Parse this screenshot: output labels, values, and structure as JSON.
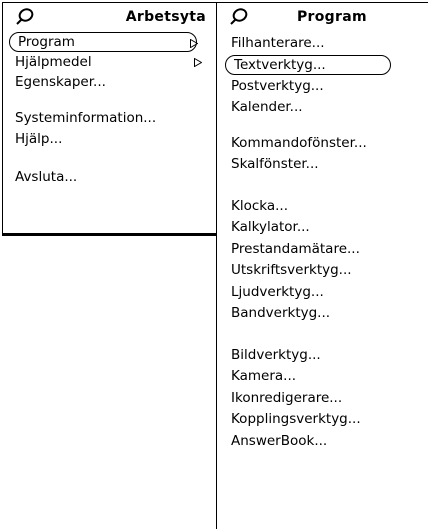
{
  "workspace_menu": {
    "title": "Arbetsyta",
    "items": [
      {
        "label": "Program",
        "icon": "submenu-arrow-icon",
        "default": true
      },
      {
        "label": "Hjälpmedel",
        "icon": "submenu-arrow-icon"
      },
      {
        "label": "Egenskaper..."
      },
      {
        "label": "Systeminformation..."
      },
      {
        "label": "Hjälp..."
      },
      {
        "label": "Avsluta..."
      }
    ]
  },
  "program_menu": {
    "title": "Program",
    "items": [
      {
        "label": "Filhanterare..."
      },
      {
        "label": "Textverktyg...",
        "default": true
      },
      {
        "label": "Postverktyg..."
      },
      {
        "label": "Kalender..."
      },
      {
        "label": "Kommandofönster..."
      },
      {
        "label": "Skalfönster..."
      },
      {
        "label": "Klocka..."
      },
      {
        "label": "Kalkylator..."
      },
      {
        "label": "Prestandamätare..."
      },
      {
        "label": "Utskriftsverktyg..."
      },
      {
        "label": "Ljudverktyg..."
      },
      {
        "label": "Bandverktyg..."
      },
      {
        "label": "Bildverktyg..."
      },
      {
        "label": "Kamera..."
      },
      {
        "label": "Ikonredigerare..."
      },
      {
        "label": "Kopplingsverktyg..."
      },
      {
        "label": "AnswerBook..."
      }
    ]
  },
  "icons": {
    "pin": "pushpin-icon",
    "submenu": "submenu-arrow-icon"
  }
}
